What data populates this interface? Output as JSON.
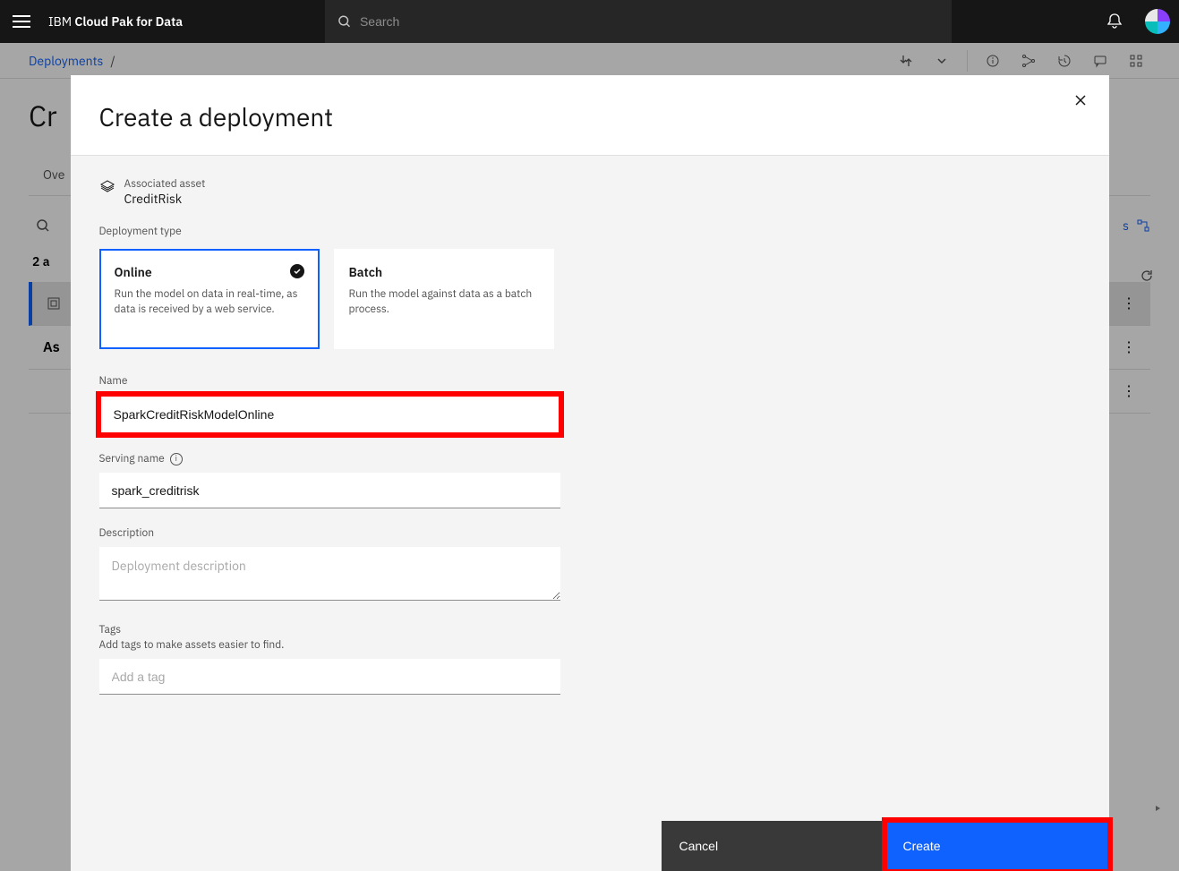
{
  "header": {
    "brand_prefix": "IBM ",
    "brand_strong": "Cloud Pak for Data",
    "search_placeholder": "Search"
  },
  "breadcrumb": {
    "items": [
      "Deployments"
    ],
    "separator": "/"
  },
  "background_page": {
    "title_partial": "Cr",
    "tab_overview_partial": "Ove",
    "count_partial": "2 a",
    "asset_label_partial": "As"
  },
  "modal": {
    "title": "Create a deployment",
    "asset": {
      "label": "Associated asset",
      "name": "CreditRisk"
    },
    "deployment_type": {
      "label": "Deployment type",
      "options": [
        {
          "title": "Online",
          "desc": "Run the model on data in real-time, as data is received by a web service.",
          "selected": true
        },
        {
          "title": "Batch",
          "desc": "Run the model against data as a batch process.",
          "selected": false
        }
      ]
    },
    "name": {
      "label": "Name",
      "value": "SparkCreditRiskModelOnline"
    },
    "serving_name": {
      "label": "Serving name",
      "value": "spark_creditrisk"
    },
    "description": {
      "label": "Description",
      "placeholder": "Deployment description"
    },
    "tags": {
      "label": "Tags",
      "sublabel": "Add tags to make assets easier to find.",
      "placeholder": "Add a tag"
    },
    "footer": {
      "cancel": "Cancel",
      "create": "Create"
    }
  }
}
